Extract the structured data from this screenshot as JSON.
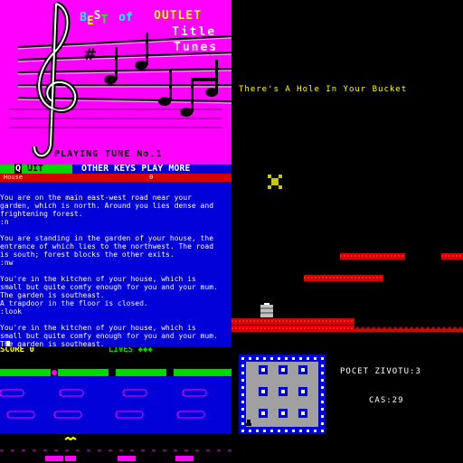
{
  "title_tunes": {
    "best_letters": [
      "B",
      "E",
      "S",
      "T"
    ],
    "best_colors": [
      "#00ffff",
      "#ffff00",
      "#ffffff",
      "#00ff00"
    ],
    "of": "of",
    "outlet": "OUTLET",
    "line2": "Title",
    "line3": "Tunes",
    "playing": "PLAYING TUNE No.1",
    "quit_key": "Q",
    "quit_rest": "UIT",
    "other_keys": "OTHER KEYS PLAY MORE"
  },
  "adventure": {
    "location": "House",
    "score": "0",
    "text": "You are on the main east-west road near your\ngarden, which is north. Around you lies dense and\nfrightening forest.\n:n\n\nYou are standing in the garden of your house, the\nentrance of which lies to the northwest. The road\nis south; forest blocks the other exits.\n:nw\n\nYou're in the kitchen of your house, which is\nsmall but quite comfy enough for you and your mum.\nThe garden is southeast.\nA trapdoor in the floor is closed.\n:look\n\nYou're in the kitchen of your house, which is\nsmall but quite comfy enough for you and your mum.\nThe garden is southeast.\nA trapdoor in the floor is closed.\n:"
  },
  "platform_game": {
    "title": "There's A Hole In Your Bucket"
  },
  "frogger": {
    "score_label": "SCORE",
    "score_value": "0",
    "lives_label": "LIVES"
  },
  "maze": {
    "lives_label": "POCET ZIVOTU:3",
    "time_label": "CAS:29"
  },
  "colors": {
    "magenta": "#ff00ff",
    "blue": "#0000d7",
    "red": "#d70000",
    "green": "#00d700",
    "yellow": "#ffff00"
  }
}
